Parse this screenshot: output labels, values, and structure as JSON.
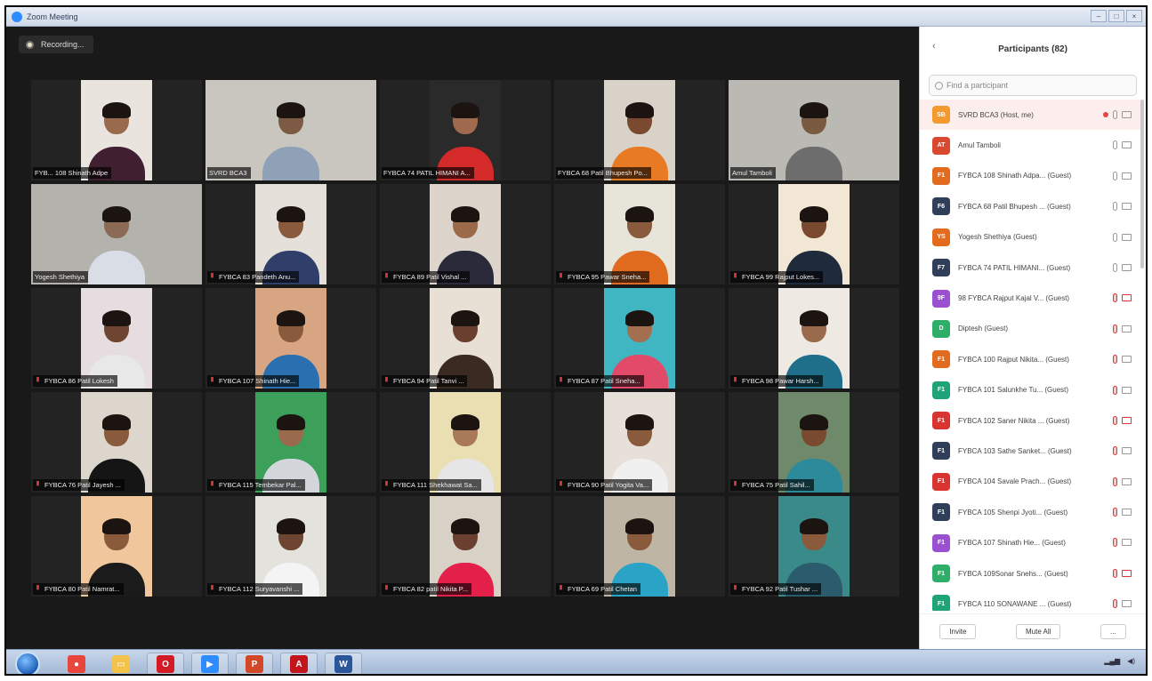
{
  "window": {
    "title": "Zoom Meeting"
  },
  "recording": {
    "label": "Recording..."
  },
  "tiles": [
    {
      "name": "FYB... 108 Shinath Adpe",
      "muted": false,
      "bg": "#e9e4de",
      "skin": "#9a6a4c",
      "shirt": "#402030",
      "full": false
    },
    {
      "name": "SVRD BCA3",
      "muted": false,
      "bg": "#c9c6bf",
      "skin": "#7d5a44",
      "shirt": "#8fa1b6",
      "full": true
    },
    {
      "name": "FYBCA 74 PATIL HIMANI A...",
      "muted": false,
      "bg": "#2a2a2a",
      "skin": "#a06a4e",
      "shirt": "#d42a2a",
      "full": false
    },
    {
      "name": "FYBCA 68 Patil Bhupesh Po...",
      "muted": false,
      "bg": "#d9d2c8",
      "skin": "#7a4a30",
      "shirt": "#e77a22",
      "full": false
    },
    {
      "name": "Amul Tamboli",
      "muted": false,
      "bg": "#bbb9b4",
      "skin": "#7b5a42",
      "shirt": "#6d6d6d",
      "full": true
    },
    {
      "name": "Yogesh Shethiya",
      "muted": false,
      "bg": "#b4b2ac",
      "skin": "#8b6b55",
      "shirt": "#d8dde6",
      "full": true
    },
    {
      "name": "FYBCA 83 Pandeth Anu...",
      "muted": true,
      "bg": "#e6e0da",
      "skin": "#8a5a3c",
      "shirt": "#2f3f6a",
      "full": false
    },
    {
      "name": "FYBCA 89 Patil Vishal ...",
      "muted": true,
      "bg": "#ddd5cc",
      "skin": "#9b6a4a",
      "shirt": "#2a2a3a",
      "full": false
    },
    {
      "name": "FYBCA 95 Pawar Sneha...",
      "muted": true,
      "bg": "#e7e4da",
      "skin": "#8a5a3c",
      "shirt": "#e06b1f",
      "full": false
    },
    {
      "name": "FYBCA 99 Rajput Lokes...",
      "muted": true,
      "bg": "#f2e6d4",
      "skin": "#7a4a30",
      "shirt": "#1f2a3a",
      "full": false
    },
    {
      "name": "FYBCA 86 Patil Lokesh",
      "muted": true,
      "bg": "#e6dde0",
      "skin": "#6e4530",
      "shirt": "#e8e8e8",
      "full": false
    },
    {
      "name": "FYBCA 107 Shinath Hie...",
      "muted": true,
      "bg": "#d8a583",
      "skin": "#8a5a3c",
      "shirt": "#2a6fb0",
      "full": false
    },
    {
      "name": "FYBCA 94 Patil Tanvi ...",
      "muted": true,
      "bg": "#e8e0d4",
      "skin": "#6b4030",
      "shirt": "#3b2a22",
      "full": false
    },
    {
      "name": "FYBCA 87 Patil Sneha...",
      "muted": true,
      "bg": "#3fb6c2",
      "skin": "#a46e50",
      "shirt": "#e24a6a",
      "full": false
    },
    {
      "name": "FYBCA 98 Pawar Harsh...",
      "muted": true,
      "bg": "#eee9e2",
      "skin": "#9a6a4c",
      "shirt": "#1f6f8a",
      "full": false
    },
    {
      "name": "FYBCA 76 Patil Jayesh ...",
      "muted": true,
      "bg": "#dcd6cc",
      "skin": "#8a5a3c",
      "shirt": "#151515",
      "full": false
    },
    {
      "name": "FYBCA 115 Tembekar Pal...",
      "muted": true,
      "bg": "#3c9f5a",
      "skin": "#9a6a4c",
      "shirt": "#d3d7dc",
      "full": false
    },
    {
      "name": "FYBCA 111 Shekhawat Sa...",
      "muted": true,
      "bg": "#e9dfb3",
      "skin": "#a87a5a",
      "shirt": "#e6e6e6",
      "full": false
    },
    {
      "name": "FYBCA 90 Patil Yogita Va...",
      "muted": true,
      "bg": "#e6e0d8",
      "skin": "#8a5a3c",
      "shirt": "#f0f0f0",
      "full": false
    },
    {
      "name": "FYBCA 75 Patil Sahil...",
      "muted": true,
      "bg": "#6f8a6a",
      "skin": "#7a4a30",
      "shirt": "#2c8a9a",
      "full": false
    },
    {
      "name": "FYBCA 80 Patil Namrat...",
      "muted": true,
      "bg": "#f0c69c",
      "skin": "#8a5a3c",
      "shirt": "#1b1b1b",
      "full": false
    },
    {
      "name": "FYBCA 112 Suryavanshi ...",
      "muted": true,
      "bg": "#e4e2dc",
      "skin": "#6e4530",
      "shirt": "#f4f4f4",
      "full": false
    },
    {
      "name": "FYBCA 82 patil Nikita P...",
      "muted": true,
      "bg": "#d8d2c6",
      "skin": "#6b4030",
      "shirt": "#e2204a",
      "full": false
    },
    {
      "name": "FYBCA 69 Patil Chetan",
      "muted": true,
      "bg": "#bfb5a4",
      "skin": "#8a5a3c",
      "shirt": "#2aa3c7",
      "full": false
    },
    {
      "name": "FYBCA 92 Patil Tushar ...",
      "muted": true,
      "bg": "#3a8a8a",
      "skin": "#8a5a3c",
      "shirt": "#2a5c6e",
      "full": false
    }
  ],
  "participants": {
    "title": "Participants (82)",
    "search_placeholder": "Find a participant",
    "invite_label": "Invite",
    "mute_all_label": "Mute All",
    "more_label": "...",
    "list": [
      {
        "initials": "SB",
        "color": "#f29a2e",
        "name": "SVRD BCA3 (Host, me)",
        "mic_off": false,
        "cam_off": false,
        "recording": true
      },
      {
        "initials": "AT",
        "color": "#d9492f",
        "name": "Amul Tamboli",
        "mic_off": false,
        "cam_off": false,
        "recording": false
      },
      {
        "initials": "F1",
        "color": "#e36b1f",
        "name": "FYBCA 108 Shinath Adpa... (Guest)",
        "mic_off": false,
        "cam_off": false,
        "recording": false
      },
      {
        "initials": "F6",
        "color": "#2f3f5a",
        "name": "FYBCA 68 Patil Bhupesh ... (Guest)",
        "mic_off": false,
        "cam_off": false,
        "recording": false
      },
      {
        "initials": "YS",
        "color": "#e36b1f",
        "name": "Yogesh Shethiya (Guest)",
        "mic_off": false,
        "cam_off": false,
        "recording": false
      },
      {
        "initials": "F7",
        "color": "#2f3f5a",
        "name": "FYBCA 74 PATIL HIMANI... (Guest)",
        "mic_off": false,
        "cam_off": false,
        "recording": false
      },
      {
        "initials": "9F",
        "color": "#9b4fd1",
        "name": "98 FYBCA Rajput Kajal V... (Guest)",
        "mic_off": true,
        "cam_off": true,
        "recording": false
      },
      {
        "initials": "D",
        "color": "#2fae6a",
        "name": "Diptesh (Guest)",
        "mic_off": true,
        "cam_off": false,
        "recording": false
      },
      {
        "initials": "F1",
        "color": "#e36b1f",
        "name": "FYBCA 100 Rajput Nikita... (Guest)",
        "mic_off": true,
        "cam_off": false,
        "recording": false
      },
      {
        "initials": "F1",
        "color": "#1fa47a",
        "name": "FYBCA 101 Salunkhe Tu... (Guest)",
        "mic_off": true,
        "cam_off": false,
        "recording": false
      },
      {
        "initials": "F1",
        "color": "#d9342f",
        "name": "FYBCA 102 Saner Nikita ... (Guest)",
        "mic_off": true,
        "cam_off": true,
        "recording": false
      },
      {
        "initials": "F1",
        "color": "#2f3f5a",
        "name": "FYBCA 103 Sathe Sanket... (Guest)",
        "mic_off": true,
        "cam_off": false,
        "recording": false
      },
      {
        "initials": "F1",
        "color": "#d9342f",
        "name": "FYBCA 104 Savale Prach... (Guest)",
        "mic_off": true,
        "cam_off": false,
        "recording": false
      },
      {
        "initials": "F1",
        "color": "#2f3f5a",
        "name": "FYBCA 105 Shenpi Jyoti... (Guest)",
        "mic_off": true,
        "cam_off": false,
        "recording": false
      },
      {
        "initials": "F1",
        "color": "#9b4fd1",
        "name": "FYBCA 107 Shinath Hie... (Guest)",
        "mic_off": true,
        "cam_off": false,
        "recording": false
      },
      {
        "initials": "F1",
        "color": "#2fae6a",
        "name": "FYBCA 109Sonar Snehs... (Guest)",
        "mic_off": true,
        "cam_off": true,
        "recording": false
      },
      {
        "initials": "F1",
        "color": "#1fa47a",
        "name": "FYBCA 110 SONAWANE ... (Guest)",
        "mic_off": true,
        "cam_off": false,
        "recording": false
      }
    ]
  },
  "taskbar": {
    "items": [
      {
        "icon": "chrome-icon",
        "color": "#e8453c"
      },
      {
        "icon": "folder-icon",
        "color": "#f2c24a"
      },
      {
        "icon": "opera-icon",
        "color": "#d21b25"
      },
      {
        "icon": "zoom-icon",
        "color": "#2d8cff"
      },
      {
        "icon": "powerpoint-icon",
        "color": "#d24726"
      },
      {
        "icon": "pdf-reader-icon",
        "color": "#c3161c"
      },
      {
        "icon": "word-icon",
        "color": "#2b579a"
      }
    ]
  }
}
